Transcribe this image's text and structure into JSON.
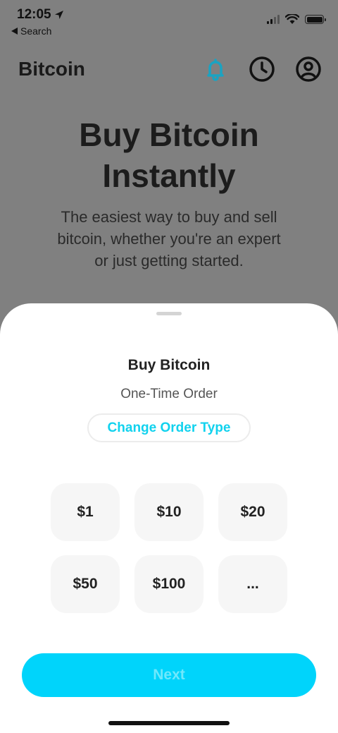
{
  "status_bar": {
    "time": "12:05",
    "back_app_label": "Search",
    "icons": [
      "location-arrow-icon",
      "cellular-signal-icon",
      "wifi-icon",
      "battery-icon"
    ]
  },
  "nav": {
    "title": "Bitcoin",
    "icons": [
      "bell-icon",
      "clock-icon",
      "profile-icon"
    ],
    "accent_color": "#1aa3c2"
  },
  "hero": {
    "title_line1": "Buy Bitcoin",
    "title_line2": "Instantly",
    "subtitle": "The easiest way to buy and sell bitcoin, whether you're an expert or just getting started."
  },
  "sheet": {
    "title": "Buy Bitcoin",
    "subtitle": "One-Time Order",
    "change_order_label": "Change Order Type",
    "amounts": [
      "$1",
      "$10",
      "$20",
      "$50",
      "$100",
      "..."
    ],
    "next_label": "Next",
    "brand_color": "#00d4fb",
    "link_color": "#11d2ee"
  }
}
